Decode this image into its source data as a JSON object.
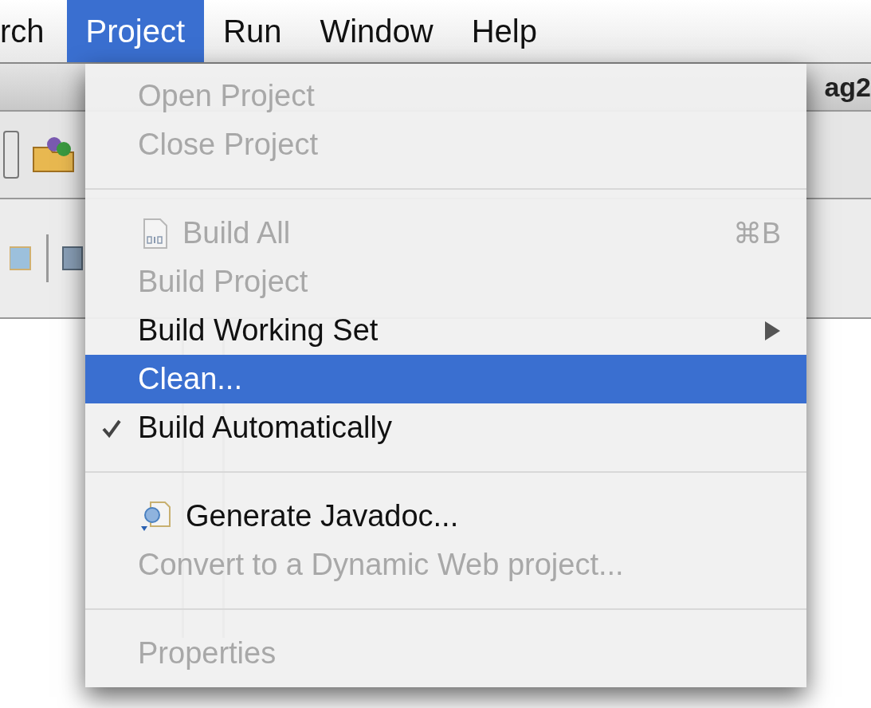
{
  "menubar": [
    {
      "label": "rch",
      "selected": false
    },
    {
      "label": "Project",
      "selected": true
    },
    {
      "label": "Run",
      "selected": false
    },
    {
      "label": "Window",
      "selected": false
    },
    {
      "label": "Help",
      "selected": false
    }
  ],
  "window": {
    "title": "ag2"
  },
  "menu": [
    {
      "kind": "item",
      "label": "Open Project",
      "disabled": true,
      "selected": false,
      "checked": false
    },
    {
      "kind": "item",
      "label": "Close Project",
      "disabled": true,
      "selected": false,
      "checked": false
    },
    {
      "kind": "separator"
    },
    {
      "kind": "binaryfile",
      "label": "Build All",
      "disabled": true,
      "selected": false,
      "checked": false,
      "shortcut": "⌘B"
    },
    {
      "kind": "item",
      "label": "Build Project",
      "disabled": true,
      "selected": false,
      "checked": false
    },
    {
      "kind": "item",
      "label": "Build Working Set",
      "disabled": false,
      "selected": false,
      "checked": false,
      "submenu": true
    },
    {
      "kind": "item",
      "label": "Clean...",
      "disabled": false,
      "selected": true,
      "checked": false
    },
    {
      "kind": "item",
      "label": "Build Automatically",
      "disabled": false,
      "selected": false,
      "checked": true
    },
    {
      "kind": "separator"
    },
    {
      "kind": "javadoc",
      "label": "Generate Javadoc...",
      "disabled": false,
      "selected": false,
      "checked": false
    },
    {
      "kind": "item",
      "label": "Convert to a Dynamic Web project...",
      "disabled": true,
      "selected": false,
      "checked": false
    },
    {
      "kind": "separator"
    },
    {
      "kind": "item",
      "label": "Properties",
      "disabled": true,
      "selected": false,
      "checked": false
    }
  ]
}
